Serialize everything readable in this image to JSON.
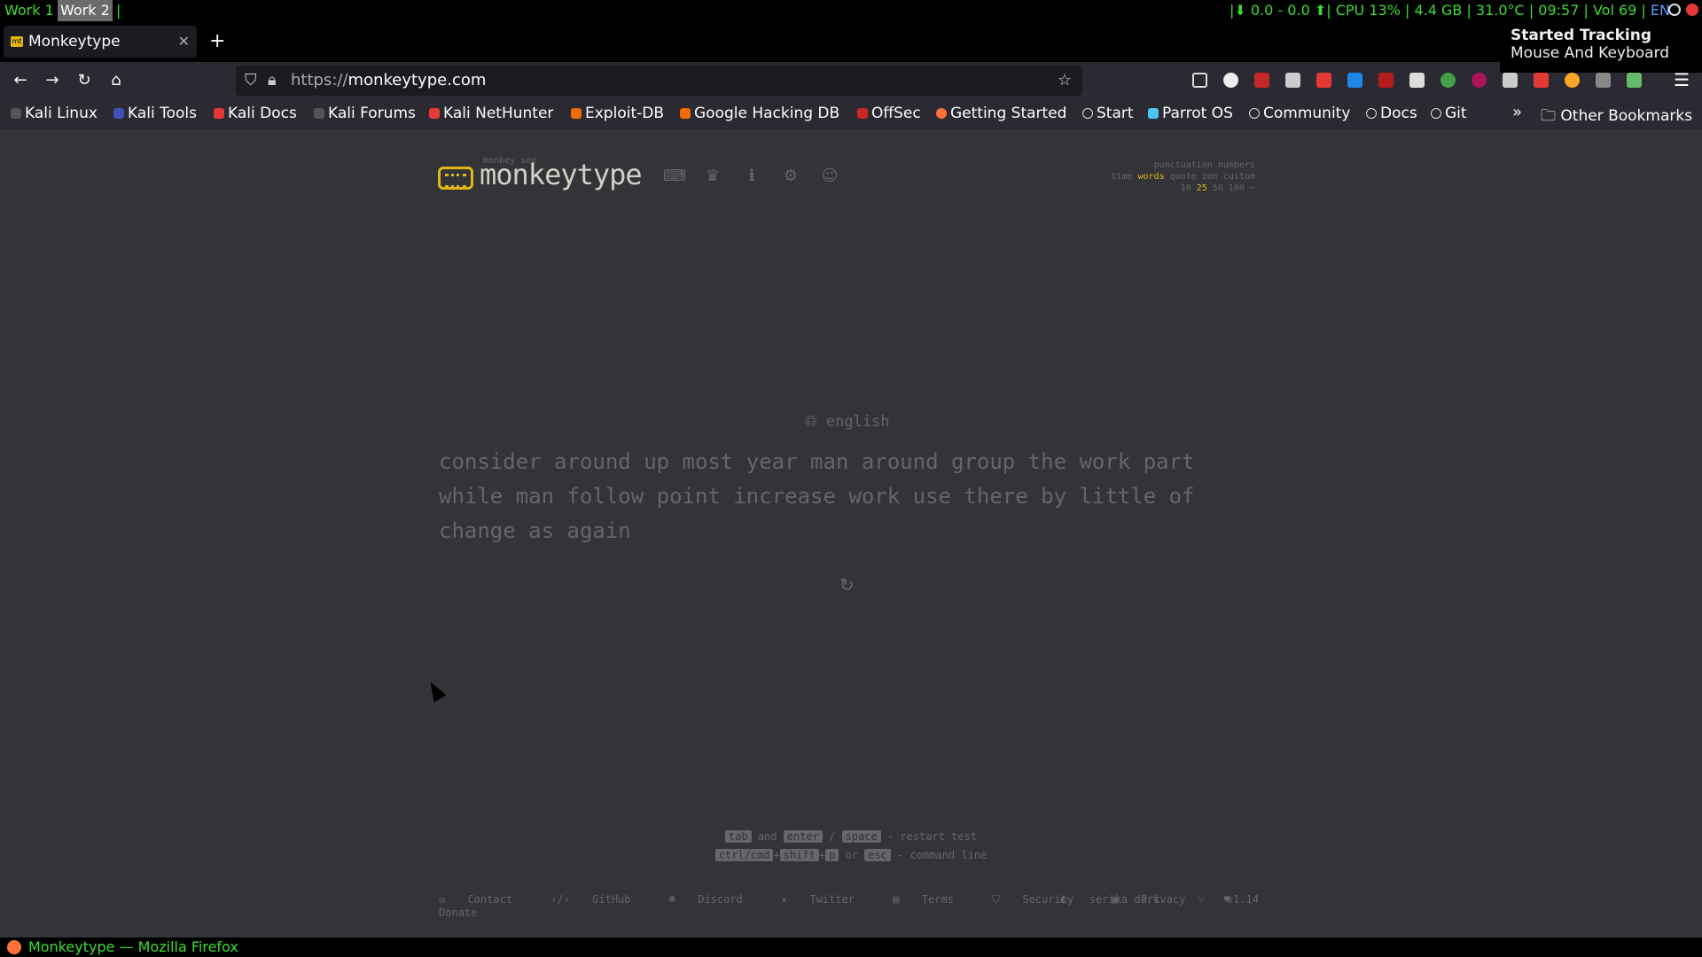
{
  "system_bar": {
    "workspace_1": "Work 1",
    "workspace_2": "Work 2",
    "separator": "|",
    "status": "|⬇ 0.0 - 0.0 ⬆| CPU 13% | 4.4 GB | 31.0°C | 09:57 | Vol 69 |",
    "lang": "EN"
  },
  "notification": {
    "title": "Started Tracking",
    "body": "Mouse And Keyboard"
  },
  "browser": {
    "tab_title": "Monkeytype",
    "tab_favicon": "mt",
    "url_protocol": "https://",
    "url_host": "monkeytype.com",
    "bookmarks": [
      "Kali Linux",
      "Kali Tools",
      "Kali Docs",
      "Kali Forums",
      "Kali NetHunter",
      "Exploit-DB",
      "Google Hacking DB",
      "OffSec",
      "Getting Started",
      "Start",
      "Parrot OS",
      "Community",
      "Docs",
      "Git"
    ],
    "other_bookmarks": "Other Bookmarks",
    "window_title": "Monkeytype — Mozilla Firefox"
  },
  "app": {
    "logo_top": "monkey see",
    "logo": "monkeytype",
    "config_row1": "punctuation numbers",
    "mode_time": "time",
    "mode_words": "words",
    "mode_quote": "quote",
    "mode_zen": "zen",
    "mode_custom": "custom",
    "count_10": "10",
    "count_25": "25",
    "count_50": "50",
    "count_100": "100",
    "language": "english",
    "words": "consider around up most year man around group the work part while man follow point increase work use there by little of change as again",
    "hints": {
      "k_tab": "tab",
      "and": "and",
      "k_enter": "enter",
      "slash": "/",
      "k_space": "space",
      "restart": "- restart test",
      "k_ctrl": "ctrl/cmd",
      "plus": "+",
      "k_shift": "shift",
      "k_p": "p",
      "or": "or",
      "k_esc": "esc",
      "command": "- command line"
    },
    "footer": {
      "contact": "Contact",
      "github": "GitHub",
      "discord": "Discord",
      "twitter": "Twitter",
      "terms": "Terms",
      "security": "Security",
      "privacy": "Privacy",
      "donate": "Donate",
      "theme": "serika dark",
      "version": "v1.14"
    }
  },
  "colors": {
    "bg": "#323437",
    "main": "#e2b714",
    "sub": "#646669",
    "text": "#d1d0c5"
  }
}
